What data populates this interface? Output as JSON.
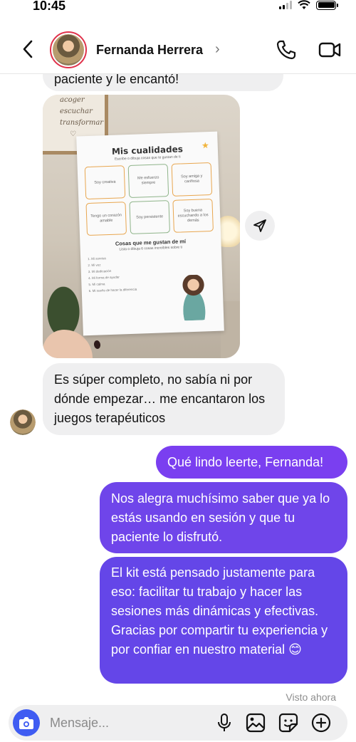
{
  "status": {
    "time": "10:45"
  },
  "header": {
    "contact_name": "Fernanda Herrera",
    "chevron": "›"
  },
  "messages": {
    "cut_top": "paciente y le encantó!",
    "incoming_1": "Es súper completo, no sabía ni por dónde empezar… me encantaron los juegos terapéuticos",
    "outgoing_1": "Qué lindo leerte, Fernanda!",
    "outgoing_2": "Nos alegra muchísimo saber que ya lo estás usando en sesión y que tu paciente lo disfrutó.",
    "outgoing_3": "El kit está pensado justamente para eso: facilitar tu trabajo y hacer las sesiones más dinámicas y efectivas. Gracias por compartir tu experiencia y por confiar en nuestro material 😊"
  },
  "photo": {
    "frame_text": [
      "acoger",
      "escuchar",
      "transformar",
      "♡"
    ],
    "worksheet": {
      "title": "Mis cualidades",
      "subtitle": "Escribe o dibuja cosas que te gustan de ti",
      "cells": [
        "Soy creativa",
        "Me esfuerzo siempre",
        "Soy amiga y cariñosa",
        "Tengo un corazón amable",
        "Soy persistente",
        "Soy buena escuchando a los demás"
      ],
      "section_title": "Cosas que me gustan de mí",
      "section_sub": "Lista o dibuja 6 cosas increíbles sobre ti",
      "lines": [
        "1. Mi sonrisa",
        "2. Mi voz",
        "3. Mi dedicación",
        "4. Mi forma de ayudar",
        "5. Mi calma",
        "6. Mi sueño de hacer la diferencia"
      ]
    }
  },
  "footer": {
    "seen": "Visto ahora"
  },
  "composer": {
    "placeholder": "Mensaje..."
  },
  "icons": {
    "back": "chevron-left-icon",
    "call": "phone-icon",
    "video": "video-camera-icon",
    "share": "send-icon",
    "camera": "camera-icon",
    "mic": "microphone-icon",
    "gallery": "image-icon",
    "sticker": "sticker-icon",
    "plus": "plus-circle-icon"
  },
  "colors": {
    "outgoing_bubble": "#7a3ff0",
    "incoming_bubble": "#efeff0",
    "camera_button": "#3f5cf2",
    "avatar_ring": "#e0324b"
  }
}
